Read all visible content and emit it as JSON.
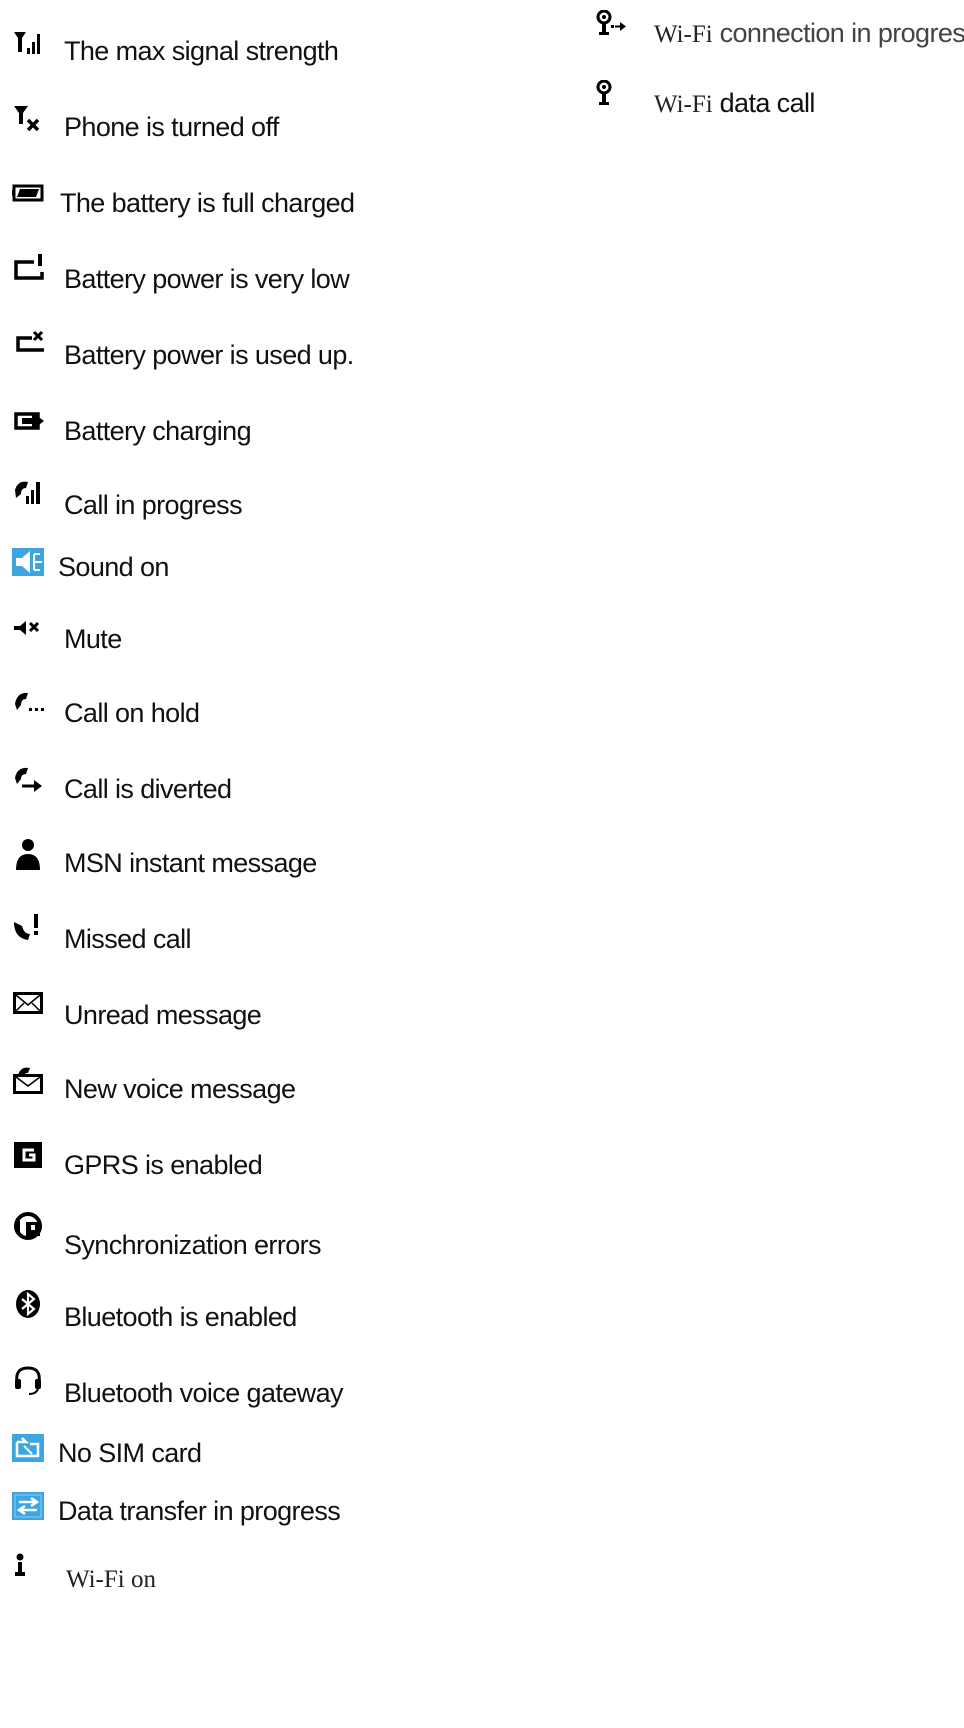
{
  "legend": {
    "signal_max": {
      "icon": "signal-strength-icon",
      "label": "The max signal strength"
    },
    "phone_off": {
      "icon": "phone-off-icon",
      "label": "Phone is turned off"
    },
    "battery_full": {
      "icon": "battery-full-icon",
      "label": "The battery is full charged"
    },
    "battery_low": {
      "icon": "battery-low-icon",
      "label": "Battery power is very low"
    },
    "battery_empty": {
      "icon": "battery-empty-icon",
      "label": "Battery power is used up."
    },
    "battery_charging": {
      "icon": "battery-charging-icon",
      "label": "Battery charging"
    },
    "call_in_progress": {
      "icon": "call-in-progress-icon",
      "label": "Call in progress"
    },
    "sound_on": {
      "icon": "speaker-icon",
      "label": "Sound on",
      "color": "#3da5e0"
    },
    "mute": {
      "icon": "mute-icon",
      "label": "Mute"
    },
    "call_on_hold": {
      "icon": "call-hold-icon",
      "label": "Call on hold"
    },
    "call_diverted": {
      "icon": "call-divert-icon",
      "label": "Call is diverted"
    },
    "msn": {
      "icon": "person-icon",
      "label": "MSN instant message"
    },
    "missed_call": {
      "icon": "missed-call-icon",
      "label": "Missed call"
    },
    "unread_message": {
      "icon": "envelope-icon",
      "label": "Unread message"
    },
    "voice_message": {
      "icon": "voicemail-icon",
      "label": "New voice message"
    },
    "gprs": {
      "icon": "gprs-icon",
      "label": "GPRS is enabled"
    },
    "sync_errors": {
      "icon": "sync-error-icon",
      "label": "Synchronization errors"
    },
    "bluetooth": {
      "icon": "bluetooth-icon",
      "label": "Bluetooth is enabled"
    },
    "bt_voice_gateway": {
      "icon": "headset-icon",
      "label": "Bluetooth voice gateway"
    },
    "no_sim": {
      "icon": "no-sim-icon",
      "label": "No SIM card",
      "color": "#3da5e0"
    },
    "data_transfer": {
      "icon": "data-transfer-icon",
      "label": "Data transfer in progress",
      "color": "#3da5e0"
    },
    "wifi_on": {
      "icon": "wifi-antenna-icon",
      "label": "Wi-Fi on"
    },
    "wifi_connecting": {
      "icon": "wifi-connecting-icon",
      "label_a": "Wi-Fi",
      "label_b": " connection in progress"
    },
    "wifi_data_call": {
      "icon": "wifi-data-call-icon",
      "label_a": "Wi-Fi",
      "label_b": " data call"
    }
  }
}
